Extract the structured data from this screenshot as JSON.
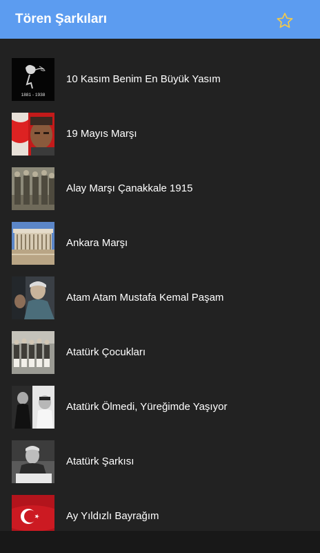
{
  "header": {
    "title": "Tören Şarkıları",
    "favorite_icon": "star-outline-icon",
    "star_color": "#f2c94c",
    "bar_color": "#5c9cf0"
  },
  "songs": [
    {
      "title": "10 Kasım Benim En Büyük Yasım",
      "thumb_caption": "1881 - 1938"
    },
    {
      "title": "19 Mayıs Marşı"
    },
    {
      "title": "Alay Marşı Çanakkale 1915"
    },
    {
      "title": "Ankara Marşı"
    },
    {
      "title": "Atam Atam Mustafa Kemal Paşam"
    },
    {
      "title": "Atatürk Çocukları"
    },
    {
      "title": "Atatürk Ölmedi, Yüreğimde Yaşıyor"
    },
    {
      "title": "Atatürk Şarkısı"
    },
    {
      "title": "Ay Yıldızlı Bayrağım"
    }
  ]
}
